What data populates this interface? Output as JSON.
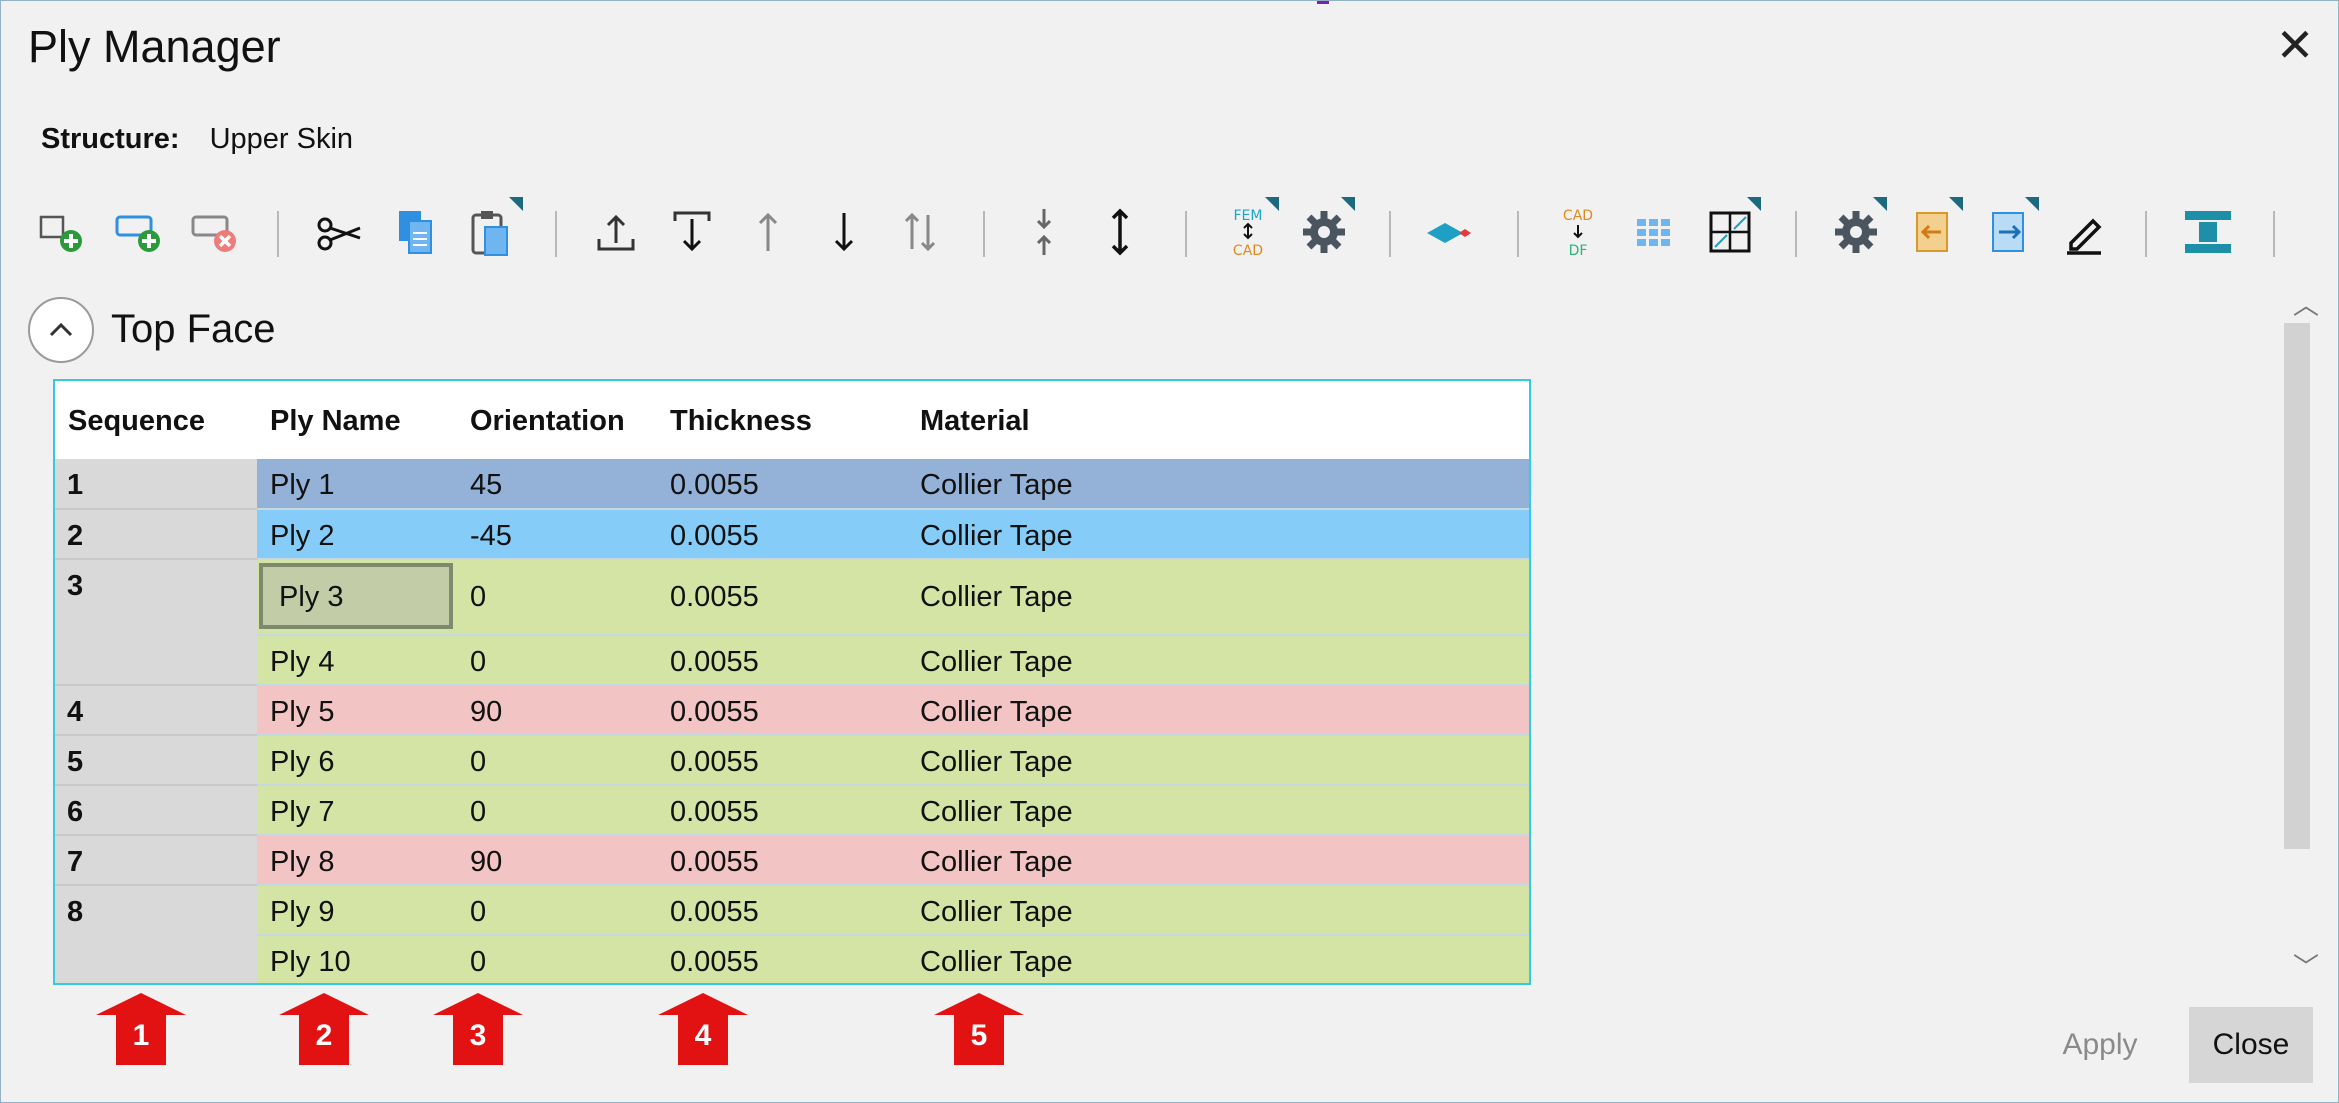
{
  "window": {
    "title": "Ply Manager",
    "close_glyph": "✕"
  },
  "structure": {
    "label": "Structure:",
    "value": "Upper Skin"
  },
  "toolbar_icons": [
    "add-ply-icon",
    "add-sequence-icon",
    "delete-ply-icon",
    "cut-icon",
    "copy-icon",
    "paste-icon",
    "move-to-top-icon",
    "move-to-bottom-icon",
    "move-up-icon",
    "move-down-icon",
    "reverse-order-icon",
    "collapse-icon",
    "expand-icon",
    "fem-cad-icon",
    "settings-icon",
    "layer-icon",
    "cad-df-icon",
    "grid-icon",
    "table-icon",
    "options-icon",
    "import-icon",
    "export-icon",
    "edit-icon",
    "symmetry-icon"
  ],
  "section": {
    "title": "Top Face",
    "toggle_glyph": "^"
  },
  "table": {
    "columns": [
      "Sequence",
      "Ply Name",
      "Orientation",
      "Thickness",
      "Material"
    ],
    "sequences": [
      "1",
      "2",
      "3",
      "4",
      "5",
      "6",
      "7",
      "8"
    ],
    "rows": [
      {
        "name": "Ply 1",
        "orientation": "45",
        "thickness": "0.0055",
        "material": "Collier Tape",
        "color": "#94b1d8"
      },
      {
        "name": "Ply 2",
        "orientation": "-45",
        "thickness": "0.0055",
        "material": "Collier Tape",
        "color": "#85cdf8"
      },
      {
        "name": "Ply 3",
        "orientation": "0",
        "thickness": "0.0055",
        "material": "Collier Tape",
        "color": "#d3e4a4"
      },
      {
        "name": "Ply 4",
        "orientation": "0",
        "thickness": "0.0055",
        "material": "Collier Tape",
        "color": "#d3e4a4"
      },
      {
        "name": "Ply 5",
        "orientation": "90",
        "thickness": "0.0055",
        "material": "Collier Tape",
        "color": "#f2c4c4"
      },
      {
        "name": "Ply 6",
        "orientation": "0",
        "thickness": "0.0055",
        "material": "Collier Tape",
        "color": "#d3e4a4"
      },
      {
        "name": "Ply 7",
        "orientation": "0",
        "thickness": "0.0055",
        "material": "Collier Tape",
        "color": "#d3e4a4"
      },
      {
        "name": "Ply 8",
        "orientation": "90",
        "thickness": "0.0055",
        "material": "Collier Tape",
        "color": "#f2c4c4"
      },
      {
        "name": "Ply 9",
        "orientation": "0",
        "thickness": "0.0055",
        "material": "Collier Tape",
        "color": "#d3e4a4"
      },
      {
        "name": "Ply 10",
        "orientation": "0",
        "thickness": "0.0055",
        "material": "Collier Tape",
        "color": "#d3e4a4"
      }
    ]
  },
  "callouts": [
    "1",
    "2",
    "3",
    "4",
    "5"
  ],
  "callout_color": "#e31212",
  "footer": {
    "apply": "Apply",
    "close": "Close"
  }
}
